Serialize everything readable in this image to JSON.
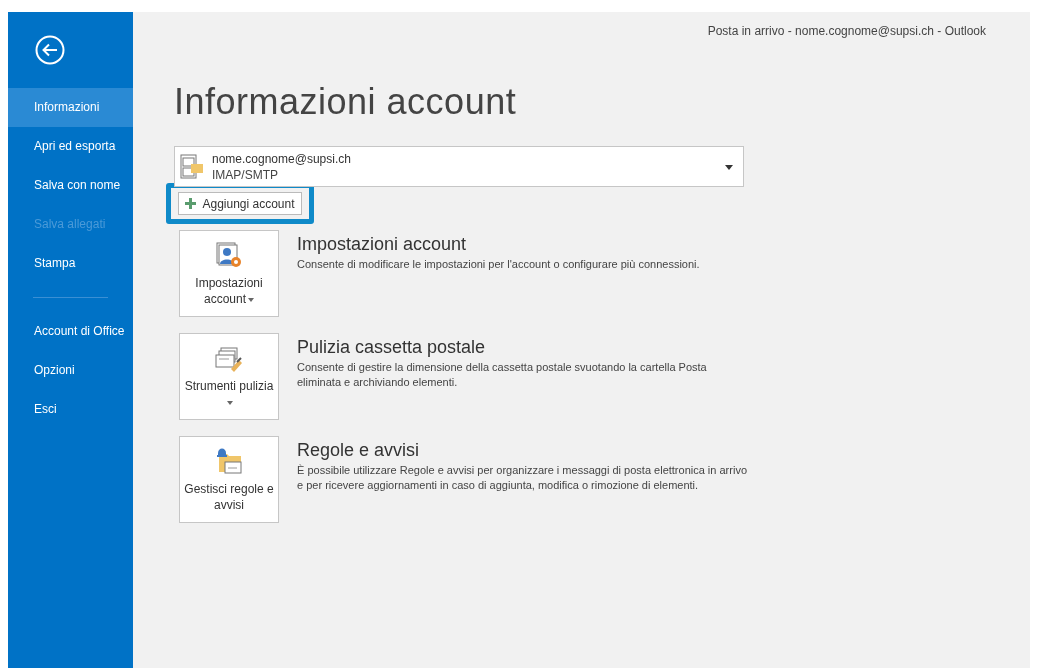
{
  "window": {
    "title": "Posta in arrivo - nome.cognome@supsi.ch - Outlook"
  },
  "sidebar": {
    "items": [
      {
        "kind": "item",
        "label": "Informazioni",
        "selected": true,
        "disabled": false
      },
      {
        "kind": "item",
        "label": "Apri ed esporta",
        "selected": false,
        "disabled": false
      },
      {
        "kind": "item",
        "label": "Salva con nome",
        "selected": false,
        "disabled": false
      },
      {
        "kind": "item",
        "label": "Salva allegati",
        "selected": false,
        "disabled": true
      },
      {
        "kind": "item",
        "label": "Stampa",
        "selected": false,
        "disabled": false
      },
      {
        "kind": "divider"
      },
      {
        "kind": "item",
        "label": "Account di Office",
        "selected": false,
        "disabled": false
      },
      {
        "kind": "item",
        "label": "Opzioni",
        "selected": false,
        "disabled": false
      },
      {
        "kind": "item",
        "label": "Esci",
        "selected": false,
        "disabled": false
      }
    ]
  },
  "heading": "Informazioni account",
  "account": {
    "email": "nome.cognome@supsi.ch",
    "type": "IMAP/SMTP"
  },
  "add_account": {
    "label": "Aggiungi account",
    "highlighted": true
  },
  "sections": [
    {
      "kind": "settings",
      "button": "Impostazioni account",
      "title": "Impostazioni account",
      "description": "Consente di modificare le impostazioni per l'account o configurare più connessioni."
    },
    {
      "kind": "cleanup",
      "button": "Strumenti pulizia",
      "title": "Pulizia cassetta postale",
      "description": "Consente di gestire la dimensione della cassetta postale svuotando la cartella Posta eliminata e archiviando elementi."
    },
    {
      "kind": "rules",
      "button": "Gestisci regole e avvisi",
      "title": "Regole e avvisi",
      "description": "È possibile utilizzare Regole e avvisi per organizzare i messaggi di posta elettronica in arrivo e per ricevere aggiornamenti in caso di aggiunta, modifica o rimozione di elementi."
    }
  ]
}
